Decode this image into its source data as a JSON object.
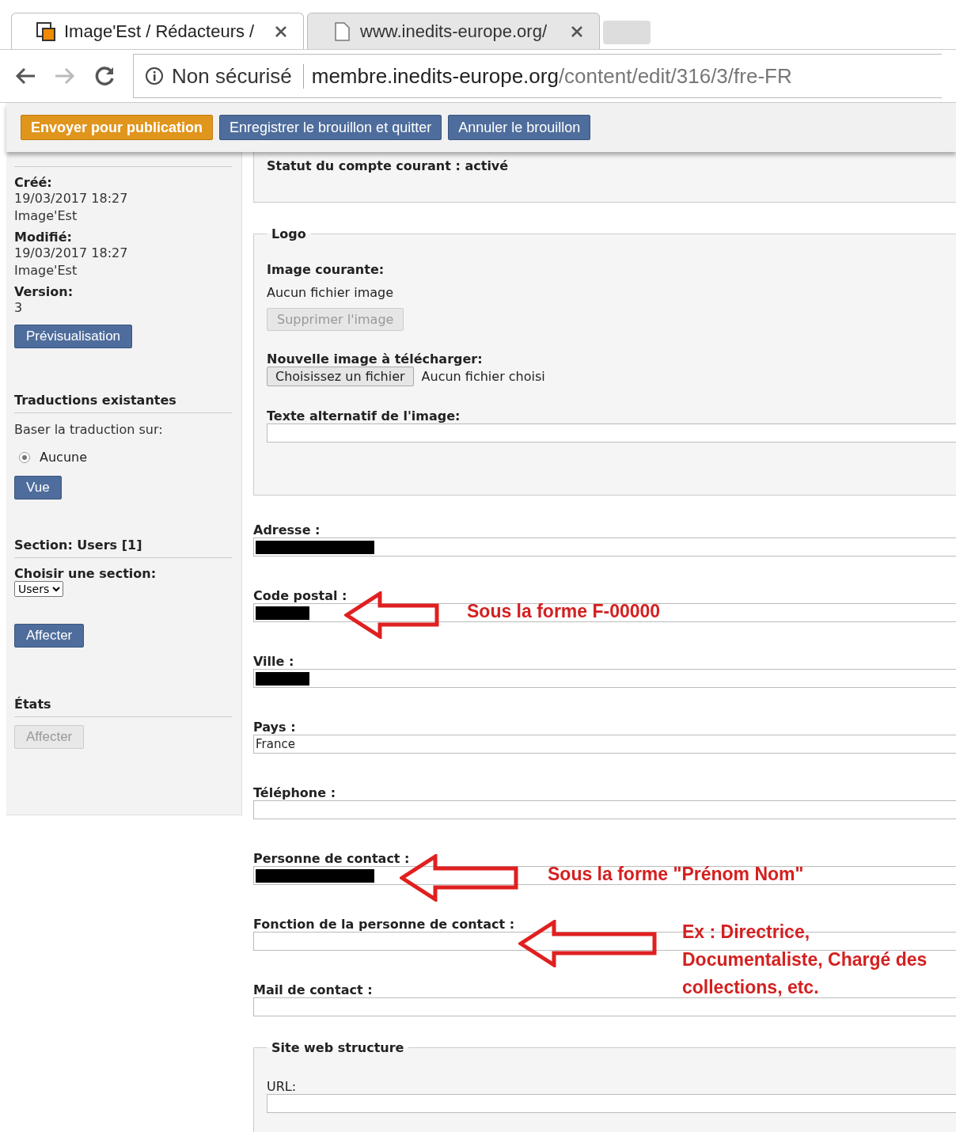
{
  "browser": {
    "tabs": [
      {
        "title": "Image'Est / Rédacteurs /",
        "selected": true
      },
      {
        "title": "www.inedits-europe.org/",
        "selected": false
      }
    ],
    "security": "Non sécurisé",
    "url_host": "membre.inedits-europe.org",
    "url_path": "/content/edit/316/3/fre-FR"
  },
  "toolbar": [
    {
      "label": "Envoyer pour publication",
      "kind": "primary"
    },
    {
      "label": "Enregistrer le brouillon et quitter",
      "kind": "secondary"
    },
    {
      "label": "Annuler le brouillon",
      "kind": "secondary"
    }
  ],
  "sidebar": {
    "info": [
      {
        "label": "Créé:",
        "lines": [
          "19/03/2017 18:27",
          "Image'Est"
        ]
      },
      {
        "label": "Modifié:",
        "lines": [
          "19/03/2017 18:27",
          "Image'Est"
        ]
      },
      {
        "label": "Version:",
        "lines": [
          "3"
        ]
      }
    ],
    "preview_button": "Prévisualisation",
    "translations_heading": "Traductions existantes",
    "base_label": "Baser la traduction sur:",
    "radio": {
      "label": "Aucune",
      "selected": true
    },
    "view_button": "Vue",
    "section_heading": "Section: Users [1]",
    "choose_label": "Choisir une section:",
    "section_select": "Users",
    "assign_button": {
      "label": "Affecter",
      "disabled": false
    },
    "states_heading": "États",
    "states_button": {
      "label": "Affecter",
      "disabled": true
    }
  },
  "status": "Statut du compte courant : activé",
  "logo": {
    "legend": "Logo",
    "current_label": "Image courante:",
    "current_value": "Aucun fichier image",
    "delete_button": {
      "label": "Supprimer l'image",
      "disabled": true
    },
    "upload_label": "Nouvelle image à télécharger:",
    "choose_button": "Choisissez un fichier",
    "no_file": "Aucun fichier choisi",
    "alt_label": "Texte alternatif de l'image:"
  },
  "fields": [
    {
      "label": "Adresse :",
      "kind": "redacted"
    },
    {
      "label": "Code postal :",
      "kind": "redacted",
      "annotation": "Sous la forme F-00000"
    },
    {
      "label": "Ville :",
      "kind": "redacted"
    },
    {
      "label": "Pays :",
      "kind": "text",
      "value": "France"
    },
    {
      "label": "Téléphone :",
      "kind": "empty"
    },
    {
      "label": "Personne de contact :",
      "kind": "redacted",
      "annotation": "Sous la forme \"Prénom Nom\""
    },
    {
      "label": "Fonction de la personne de contact :",
      "kind": "empty",
      "annotation": "Ex : Directrice, Documentaliste, Chargé des collections, etc."
    },
    {
      "label": "Mail de contact :",
      "kind": "empty"
    }
  ],
  "website": {
    "legend": "Site web structure",
    "url_label": "URL:"
  }
}
